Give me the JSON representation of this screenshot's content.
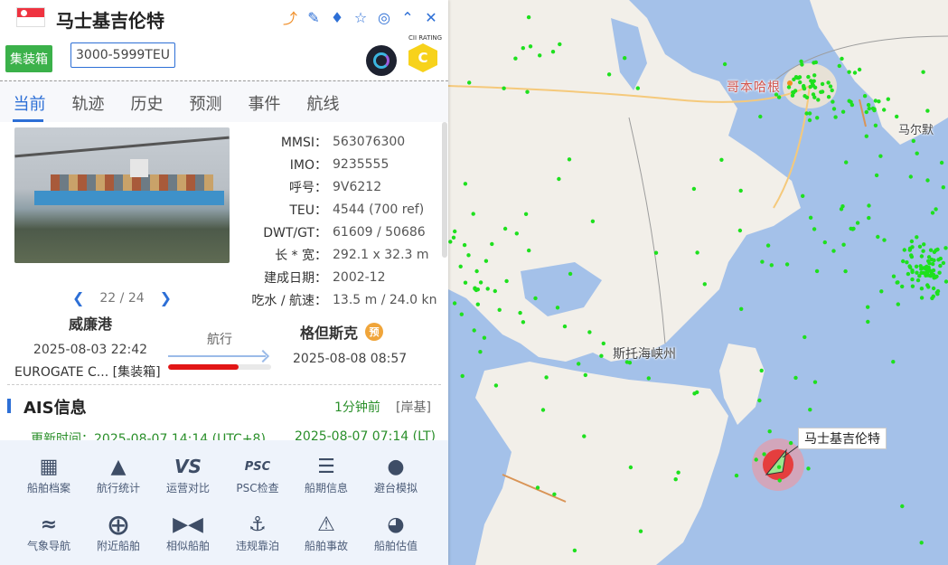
{
  "ship": {
    "name": "马士基吉伦特",
    "type_tag": "集装箱",
    "teu_class": "3000-5999TEU",
    "cii_title": "CII RATING",
    "cii_grade": "C",
    "flag": "singapore-flag-icon"
  },
  "header_icons": [
    "share-icon",
    "edit-icon",
    "tag-icon",
    "star-icon",
    "locate-icon",
    "collapse-icon",
    "close-icon"
  ],
  "tabs": [
    {
      "label": "当前",
      "active": true
    },
    {
      "label": "轨迹"
    },
    {
      "label": "历史"
    },
    {
      "label": "预测"
    },
    {
      "label": "事件"
    },
    {
      "label": "航线"
    }
  ],
  "photo": {
    "index": "22",
    "total": "24",
    "sep": "/"
  },
  "details": [
    {
      "key": "MMSI：",
      "value": "563076300"
    },
    {
      "key": "IMO：",
      "value": "9235555"
    },
    {
      "key": "呼号：",
      "value": "9V6212"
    },
    {
      "key": "TEU：",
      "value": "4544 (700 ref)"
    },
    {
      "key": "DWT/GT：",
      "value": "61609 / 50686"
    },
    {
      "key": "长 * 宽：",
      "value": "292.1 x 32.3 m"
    },
    {
      "key": "建成日期：",
      "value": "2002-12"
    },
    {
      "key": "吃水 / 航速：",
      "value": "13.5 m / 24.0 kn"
    }
  ],
  "voyage": {
    "from_port": "威廉港",
    "from_time": "2025-08-03 22:42",
    "from_terminal": "EUROGATE C... [集装箱]",
    "status": "航行",
    "progress": 0.68,
    "to_port": "格但斯克",
    "to_badge": "预",
    "to_time": "2025-08-08 08:57"
  },
  "ais": {
    "title": "AIS信息",
    "age": "1分钟前",
    "source": "[岸基]",
    "updated_label": "更新时间：",
    "updated_utc": "2025-08-07 14:14 (UTC+8)",
    "updated_lt": "2025-08-07 07:14 (LT)"
  },
  "tools": [
    {
      "label": "船舶档案",
      "icon": "archive-icon"
    },
    {
      "label": "航行统计",
      "icon": "stats-icon"
    },
    {
      "label": "运营对比",
      "icon": "vs-icon"
    },
    {
      "label": "PSC检查",
      "icon": "psc-icon"
    },
    {
      "label": "船期信息",
      "icon": "schedule-icon"
    },
    {
      "label": "避台模拟",
      "icon": "typhoon-icon"
    },
    {
      "label": "气象导航",
      "icon": "weather-route-icon"
    },
    {
      "label": "附近船舶",
      "icon": "compass-icon"
    },
    {
      "label": "相似船舶",
      "icon": "similar-ship-icon"
    },
    {
      "label": "违规靠泊",
      "icon": "anchor-icon"
    },
    {
      "label": "船舶事故",
      "icon": "accident-icon"
    },
    {
      "label": "船舶估值",
      "icon": "valuation-icon"
    }
  ],
  "map": {
    "labels": {
      "copenhagen": "哥本哈根",
      "malmo": "马尔默",
      "strait": "斯托海峡州"
    },
    "ship_callout": "马士基吉伦特",
    "colors": {
      "sea": "#a4c1e9",
      "land": "#f2efe9",
      "vessel_dot": "#1ee01e",
      "ship_marker": "#e53e3e"
    }
  }
}
